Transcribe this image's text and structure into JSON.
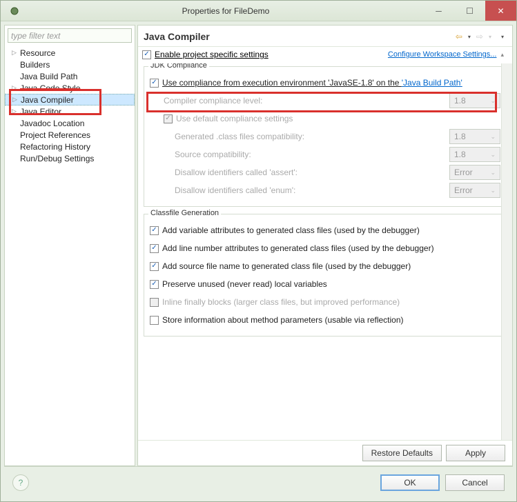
{
  "window": {
    "title": "Properties for FileDemo"
  },
  "sidebar": {
    "filter_placeholder": "type filter text",
    "items": [
      {
        "label": "Resource",
        "expandable": true
      },
      {
        "label": "Builders",
        "expandable": false
      },
      {
        "label": "Java Build Path",
        "expandable": false
      },
      {
        "label": "Java Code Style",
        "expandable": true
      },
      {
        "label": "Java Compiler",
        "expandable": true,
        "selected": true
      },
      {
        "label": "Java Editor",
        "expandable": true
      },
      {
        "label": "Javadoc Location",
        "expandable": false
      },
      {
        "label": "Project References",
        "expandable": false
      },
      {
        "label": "Refactoring History",
        "expandable": false
      },
      {
        "label": "Run/Debug Settings",
        "expandable": false
      }
    ]
  },
  "panel": {
    "title": "Java Compiler",
    "enable_project": "Enable project specific settings",
    "configure_workspace": "Configure Workspace Settings..."
  },
  "jdk": {
    "group_title": "JDK Compliance",
    "use_compliance_prefix": "Use compliance from execution environment 'JavaSE-1.8' on the ",
    "java_build_path_link": "'Java Build Path'",
    "compiler_level_label": "Compiler compliance level:",
    "compiler_level_value": "1.8",
    "use_default": "Use default compliance settings",
    "gen_class_compat": "Generated .class files compatibility:",
    "gen_class_value": "1.8",
    "source_compat": "Source compatibility:",
    "source_value": "1.8",
    "disallow_assert": "Disallow identifiers called 'assert':",
    "disallow_assert_value": "Error",
    "disallow_enum": "Disallow identifiers called 'enum':",
    "disallow_enum_value": "Error"
  },
  "classfile": {
    "group_title": "Classfile Generation",
    "add_var": "Add variable attributes to generated class files (used by the debugger)",
    "add_line": "Add line number attributes to generated class files (used by the debugger)",
    "add_source": "Add source file name to generated class file (used by the debugger)",
    "preserve": "Preserve unused (never read) local variables",
    "inline": "Inline finally blocks (larger class files, but improved performance)",
    "store_info": "Store information about method parameters (usable via reflection)"
  },
  "buttons": {
    "restore": "Restore Defaults",
    "apply": "Apply",
    "ok": "OK",
    "cancel": "Cancel"
  }
}
